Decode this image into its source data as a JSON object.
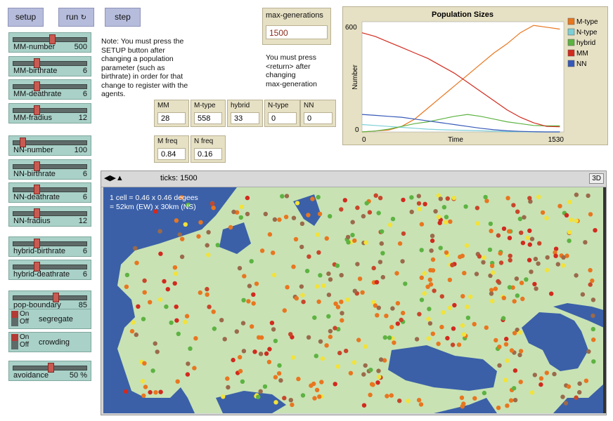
{
  "buttons": {
    "setup": "setup",
    "run": "run",
    "step": "step"
  },
  "sliders": [
    {
      "label": "MM-number",
      "value": "500",
      "frac": 0.52
    },
    {
      "label": "MM-birthrate",
      "value": "6",
      "frac": 0.3
    },
    {
      "label": "MM-deathrate",
      "value": "6",
      "frac": 0.3
    },
    {
      "label": "MM-fradius",
      "value": "12",
      "frac": 0.3
    },
    {
      "label": "NN-number",
      "value": "100",
      "frac": 0.1
    },
    {
      "label": "NN-birthrate",
      "value": "6",
      "frac": 0.3
    },
    {
      "label": "NN-deathrate",
      "value": "6",
      "frac": 0.3
    },
    {
      "label": "NN-fradius",
      "value": "12",
      "frac": 0.3
    },
    {
      "label": "hybrid-birthrate",
      "value": "6",
      "frac": 0.3
    },
    {
      "label": "hybrid-deathrate",
      "value": "6",
      "frac": 0.3
    },
    {
      "label": "pop-boundary",
      "value": "85",
      "frac": 0.57
    },
    {
      "label": "avoidance",
      "value": "50 %",
      "frac": 0.5
    }
  ],
  "switches": [
    {
      "label": "segregate",
      "on": "On",
      "off": "Off"
    },
    {
      "label": "crowding",
      "on": "On",
      "off": "Off"
    }
  ],
  "note1": [
    "Note: You must press the",
    "SETUP button after",
    "changing a population",
    "parameter (such as",
    "birthrate) in order for that",
    "change to register with the",
    "agents."
  ],
  "max_generations": {
    "label": "max-generations",
    "value": "1500"
  },
  "note2": [
    "You must press",
    "<return> after",
    "changing",
    "max-generation"
  ],
  "monitors": [
    {
      "label": "MM",
      "value": "28"
    },
    {
      "label": "M-type",
      "value": "558"
    },
    {
      "label": "hybrid",
      "value": "33"
    },
    {
      "label": "N-type",
      "value": "0"
    },
    {
      "label": "NN",
      "value": "0"
    },
    {
      "label": "M freq",
      "value": "0.84"
    },
    {
      "label": "N freq",
      "value": "0.16"
    }
  ],
  "plot": {
    "title": "Population Sizes",
    "ylabel": "Number",
    "xlabel": "Time",
    "ymax_label": "600",
    "ymin_label": "0",
    "xmin_label": "0",
    "xmax_label": "1530",
    "legend": [
      {
        "name": "M-type",
        "color": "#e8761f"
      },
      {
        "name": "N-type",
        "color": "#7ccfd6"
      },
      {
        "name": "hybrid",
        "color": "#5db341"
      },
      {
        "name": "MM",
        "color": "#d22a1e"
      },
      {
        "name": "NN",
        "color": "#3659b8"
      }
    ]
  },
  "chart_data": {
    "type": "line",
    "title": "Population Sizes",
    "xlabel": "Time",
    "ylabel": "Number",
    "xlim": [
      0,
      1530
    ],
    "ylim": [
      0,
      600
    ],
    "x": [
      0,
      100,
      200,
      300,
      400,
      500,
      600,
      700,
      800,
      900,
      1000,
      1100,
      1200,
      1300,
      1400,
      1500
    ],
    "series": [
      {
        "name": "M-type",
        "values": [
          0,
          5,
          10,
          30,
          70,
          130,
          190,
          250,
          310,
          370,
          430,
          480,
          540,
          580,
          570,
          560
        ]
      },
      {
        "name": "N-type",
        "values": [
          40,
          35,
          30,
          25,
          20,
          15,
          12,
          10,
          8,
          6,
          4,
          2,
          1,
          0,
          0,
          0
        ]
      },
      {
        "name": "hybrid",
        "values": [
          0,
          5,
          15,
          30,
          45,
          55,
          70,
          85,
          95,
          85,
          70,
          55,
          45,
          35,
          33,
          33
        ]
      },
      {
        "name": "MM",
        "values": [
          540,
          520,
          490,
          460,
          430,
          400,
          360,
          320,
          270,
          220,
          170,
          120,
          80,
          50,
          30,
          28
        ]
      },
      {
        "name": "NN",
        "values": [
          95,
          90,
          85,
          80,
          70,
          60,
          50,
          40,
          30,
          20,
          12,
          6,
          3,
          1,
          0,
          0
        ]
      }
    ]
  },
  "view": {
    "ticks_label": "ticks: 1500",
    "btn_3d": "3D",
    "info": [
      "1 cell = 0.46 x 0.46 degees",
      "= 52km (EW) x 30km (NS)"
    ],
    "water_color": "#3b60a8",
    "land_color": "#c8e2b4"
  }
}
